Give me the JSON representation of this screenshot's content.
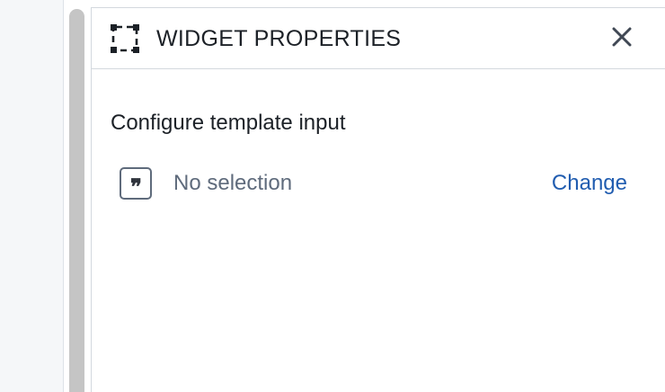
{
  "panel": {
    "title": "WIDGET PROPERTIES",
    "header_icon": "widget-frame-icon",
    "close_icon": "close-icon"
  },
  "template_input": {
    "label": "Configure template input",
    "type_icon": "quote-icon",
    "type_icon_glyph": "❞",
    "value": "No selection",
    "change_label": "Change"
  },
  "colors": {
    "link": "#215db0",
    "muted_text": "#5f6b7c",
    "text": "#1c2127",
    "border": "#d3d8de",
    "scroll_track": "#c5c5c5"
  }
}
